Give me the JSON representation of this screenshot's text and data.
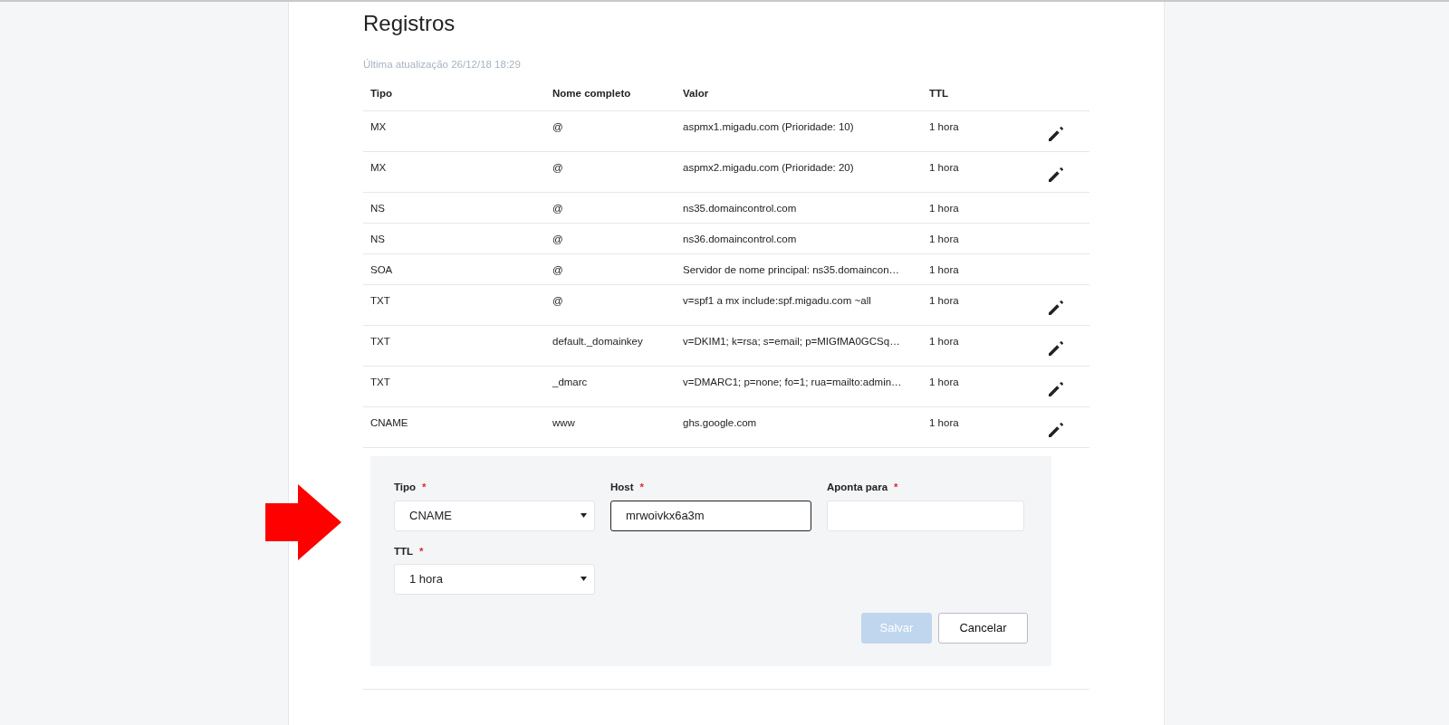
{
  "title": "Registros",
  "last_updated": "Última atualização 26/12/18 18:29",
  "table": {
    "columns": [
      "Tipo",
      "Nome completo",
      "Valor",
      "TTL"
    ],
    "rows": [
      {
        "type": "MX",
        "name": "@",
        "value": "aspmx1.migadu.com (Prioridade: 10)",
        "ttl": "1 hora",
        "editable": true
      },
      {
        "type": "MX",
        "name": "@",
        "value": "aspmx2.migadu.com (Prioridade: 20)",
        "ttl": "1 hora",
        "editable": true
      },
      {
        "type": "NS",
        "name": "@",
        "value": "ns35.domaincontrol.com",
        "ttl": "1 hora",
        "editable": false
      },
      {
        "type": "NS",
        "name": "@",
        "value": "ns36.domaincontrol.com",
        "ttl": "1 hora",
        "editable": false
      },
      {
        "type": "SOA",
        "name": "@",
        "value": "Servidor de nome principal: ns35.domaincon…",
        "ttl": "1 hora",
        "editable": false
      },
      {
        "type": "TXT",
        "name": "@",
        "value": "v=spf1 a mx include:spf.migadu.com ~all",
        "ttl": "1 hora",
        "editable": true
      },
      {
        "type": "TXT",
        "name": "default._domainkey",
        "value": "v=DKIM1; k=rsa; s=email; p=MIGfMA0GCSq…",
        "ttl": "1 hora",
        "editable": true
      },
      {
        "type": "TXT",
        "name": "_dmarc",
        "value": "v=DMARC1; p=none; fo=1; rua=mailto:admin…",
        "ttl": "1 hora",
        "editable": true
      },
      {
        "type": "CNAME",
        "name": "www",
        "value": "ghs.google.com",
        "ttl": "1 hora",
        "editable": true
      }
    ]
  },
  "form": {
    "fields": [
      {
        "kind": "select",
        "label": "Tipo",
        "required_mark": "*",
        "value": "CNAME",
        "focused": false
      },
      {
        "kind": "text",
        "label": "Host",
        "required_mark": "*",
        "value": "mrwoivkx6a3m",
        "focused": true
      },
      {
        "kind": "text",
        "label": "Aponta para",
        "required_mark": "*",
        "focused": false
      },
      {
        "kind": "select",
        "label": "TTL",
        "required_mark": "*",
        "value": "1 hora",
        "focused": false
      }
    ],
    "buttons": [
      {
        "label": "Salvar",
        "kind": "primary",
        "disabled": true
      },
      {
        "label": "Cancelar",
        "kind": "secondary",
        "disabled": false
      }
    ]
  }
}
